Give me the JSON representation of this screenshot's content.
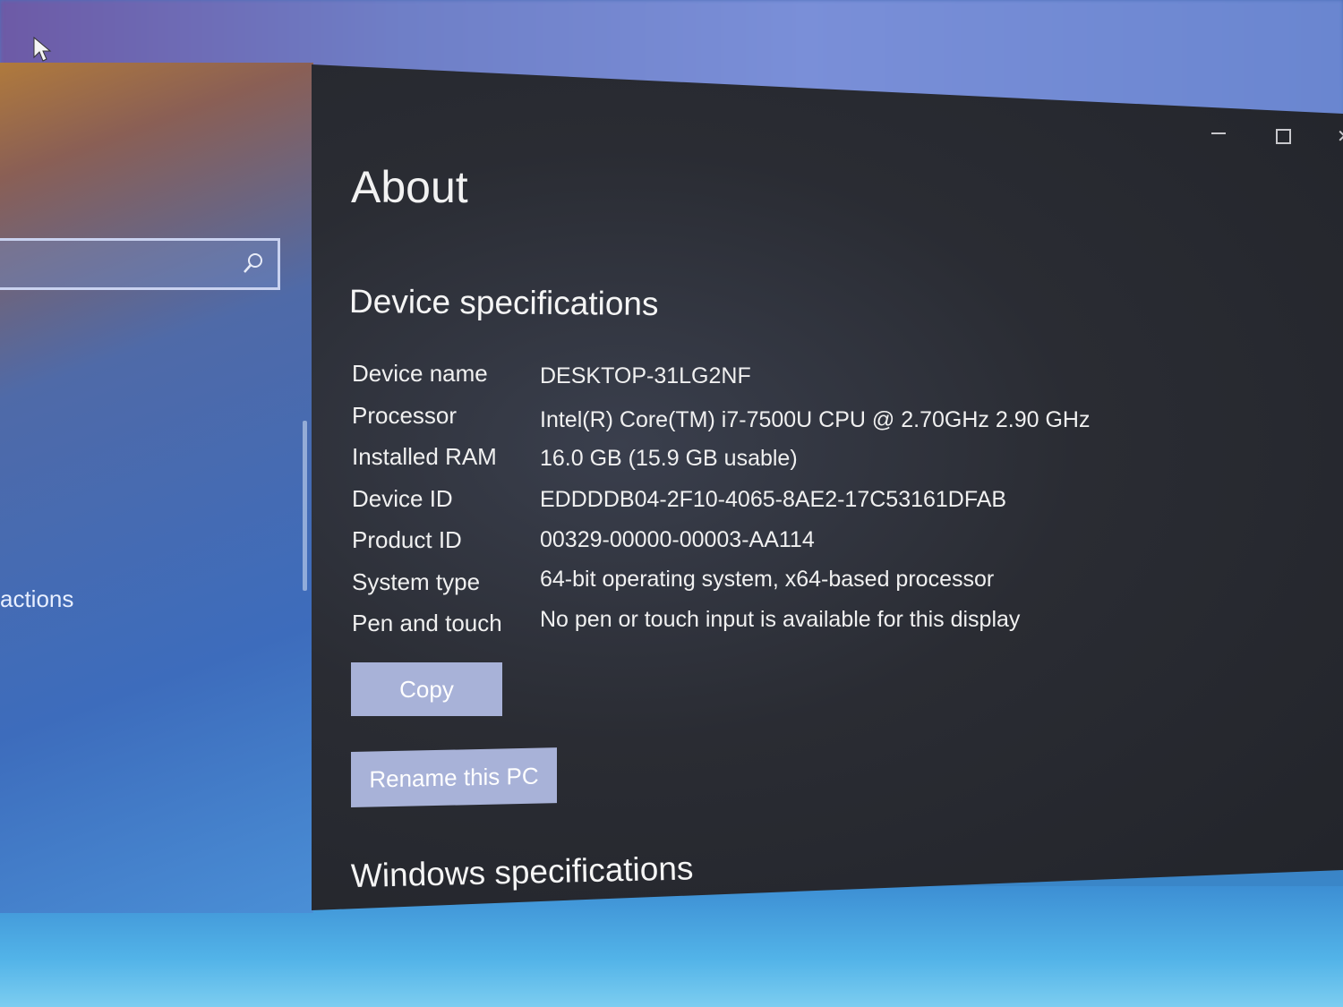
{
  "sidebar": {
    "search_placeholder": "",
    "actions_label": "actions"
  },
  "window": {
    "close_glyph": "✕"
  },
  "page": {
    "title": "About",
    "section_title": "Device specifications",
    "specs": [
      {
        "label": "Device name",
        "value": "DESKTOP-31LG2NF"
      },
      {
        "label": "Processor",
        "value": "Intel(R) Core(TM) i7-7500U CPU @ 2.70GHz   2.90 GHz"
      },
      {
        "label": "Installed RAM",
        "value": "16.0 GB (15.9 GB usable)"
      },
      {
        "label": "Device ID",
        "value": "EDDDDB04-2F10-4065-8AE2-17C53161DFAB"
      },
      {
        "label": "Product ID",
        "value": "00329-00000-00003-AA114"
      },
      {
        "label": "System type",
        "value": "64-bit operating system, x64-based processor"
      },
      {
        "label": "Pen and touch",
        "value": "No pen or touch input is available for this display"
      }
    ],
    "copy_label": "Copy",
    "rename_label": "Rename this PC",
    "windows_section_title": "Windows specifications"
  },
  "colors": {
    "panel_bg": "#2a2c33",
    "button_bg": "#a8b2d8",
    "text": "#f0f0f0"
  }
}
